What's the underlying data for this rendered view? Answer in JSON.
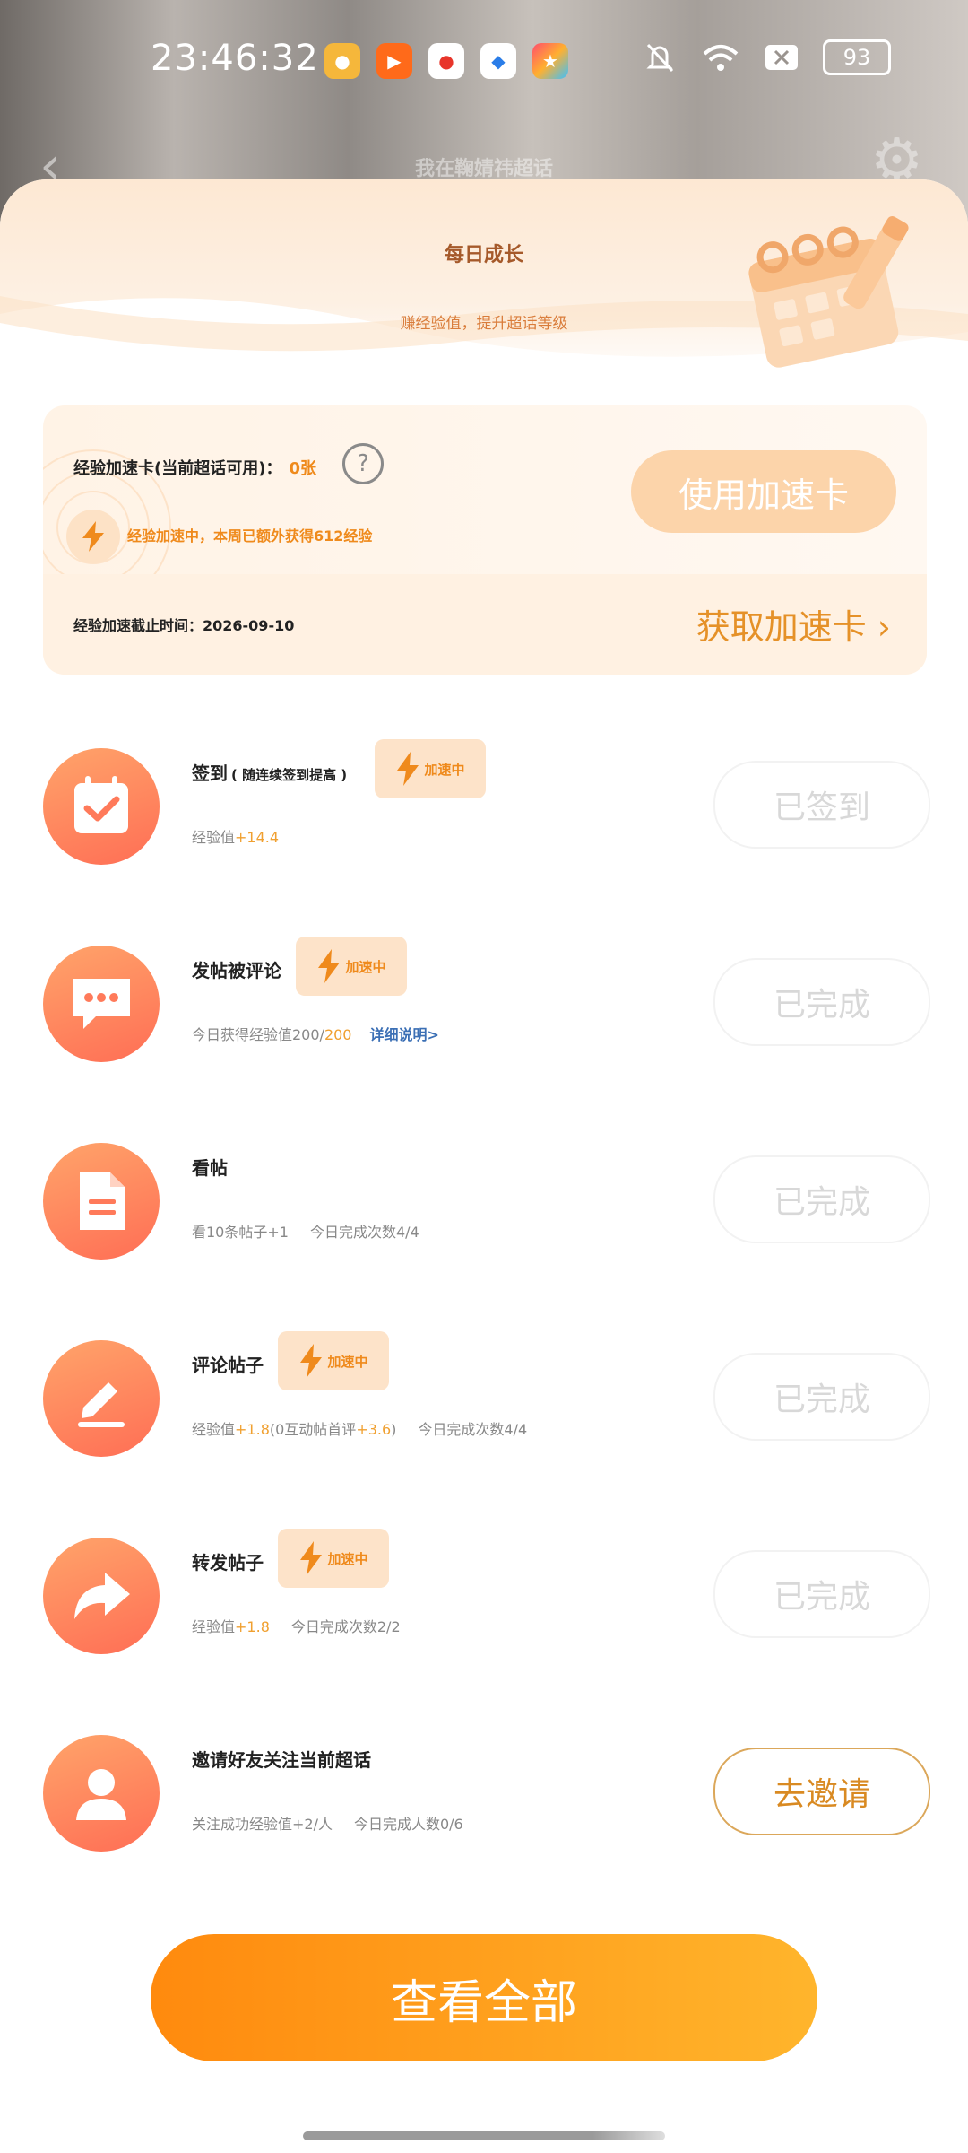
{
  "status_bar": {
    "time": "23:46:32",
    "battery": "93",
    "icons": [
      "weibo-icon",
      "kuaishou-icon",
      "weibo-icon",
      "browser-icon",
      "star-app-icon",
      "mute-icon",
      "wifi-icon",
      "sim-off-icon",
      "battery-icon"
    ]
  },
  "nav": {
    "title": "我在鞠婧祎超话"
  },
  "hero": {
    "title": "每日成长",
    "subtitle": "赚经验值，提升超话等级"
  },
  "accelerator": {
    "label": "经验加速卡(当前超话可用)：",
    "count": "0张",
    "status": "经验加速中，本周已额外获得612经验",
    "use_button": "使用加速卡",
    "deadline": "经验加速截止时间：2026-09-10",
    "get_link": "获取加速卡"
  },
  "speed_tag_label": "加速中",
  "tasks": [
    {
      "title": "签到",
      "title_note": "( 随连续签到提高 )",
      "desc_prefix": "经验值",
      "desc_value": "+14.4",
      "button": "已签到"
    },
    {
      "title": "发帖被评论",
      "desc_prefix": "今日获得经验值200/",
      "desc_value": "200",
      "desc_link": "详细说明>",
      "button": "已完成"
    },
    {
      "title": "看帖",
      "desc_a": "看10条帖子+1",
      "desc_b": "今日完成次数4/4",
      "button": "已完成"
    },
    {
      "title": "评论帖子",
      "desc_prefix": "经验值",
      "desc_value": "+1.8",
      "desc_mid": "(0互动帖首评",
      "desc_value2": "+3.6",
      "desc_close": ")",
      "desc_b": "今日完成次数4/4",
      "button": "已完成"
    },
    {
      "title": "转发帖子",
      "desc_prefix": "经验值",
      "desc_value": "+1.8",
      "desc_b": "今日完成次数2/2",
      "button": "已完成"
    },
    {
      "title": "邀请好友关注当前超话",
      "desc_a": "关注成功经验值+2/人",
      "desc_b": "今日完成人数0/6",
      "button": "去邀请"
    }
  ],
  "view_all": "查看全部",
  "colors": {
    "accent": "#ef8a1c",
    "button_gradient_start": "#ff8a0e",
    "button_gradient_end": "#ffb52c",
    "icon_gradient_start": "#ffa46a",
    "icon_gradient_end": "#ff6e55"
  }
}
